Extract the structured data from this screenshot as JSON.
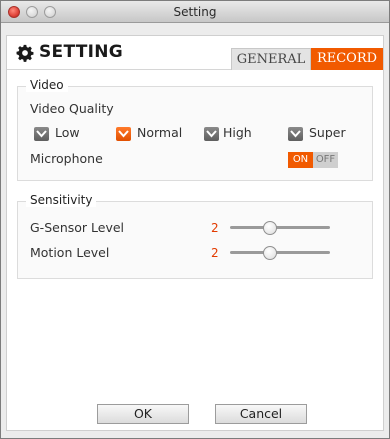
{
  "window": {
    "title": "Setting"
  },
  "header": {
    "title": "SETTING"
  },
  "tabs": [
    {
      "label": "GENERAL",
      "active": false
    },
    {
      "label": "RECORD",
      "active": true
    }
  ],
  "video": {
    "legend": "Video",
    "quality_label": "Video Quality",
    "options": [
      {
        "label": "Low",
        "checked": false
      },
      {
        "label": "Normal",
        "checked": true
      },
      {
        "label": "High",
        "checked": false
      },
      {
        "label": "Super",
        "checked": false
      }
    ],
    "microphone_label": "Microphone",
    "microphone_on_label": "ON",
    "microphone_off_label": "OFF",
    "microphone_state": "ON"
  },
  "sensitivity": {
    "legend": "Sensitivity",
    "gsensor_label": "G-Sensor Level",
    "gsensor_value": "2",
    "gsensor_level_fraction": 0.4,
    "motion_label": "Motion Level",
    "motion_value": "2",
    "motion_level_fraction": 0.4
  },
  "buttons": {
    "ok_label": "OK",
    "cancel_label": "Cancel"
  },
  "colors": {
    "accent": "#f15a00",
    "value": "#e23b00"
  }
}
